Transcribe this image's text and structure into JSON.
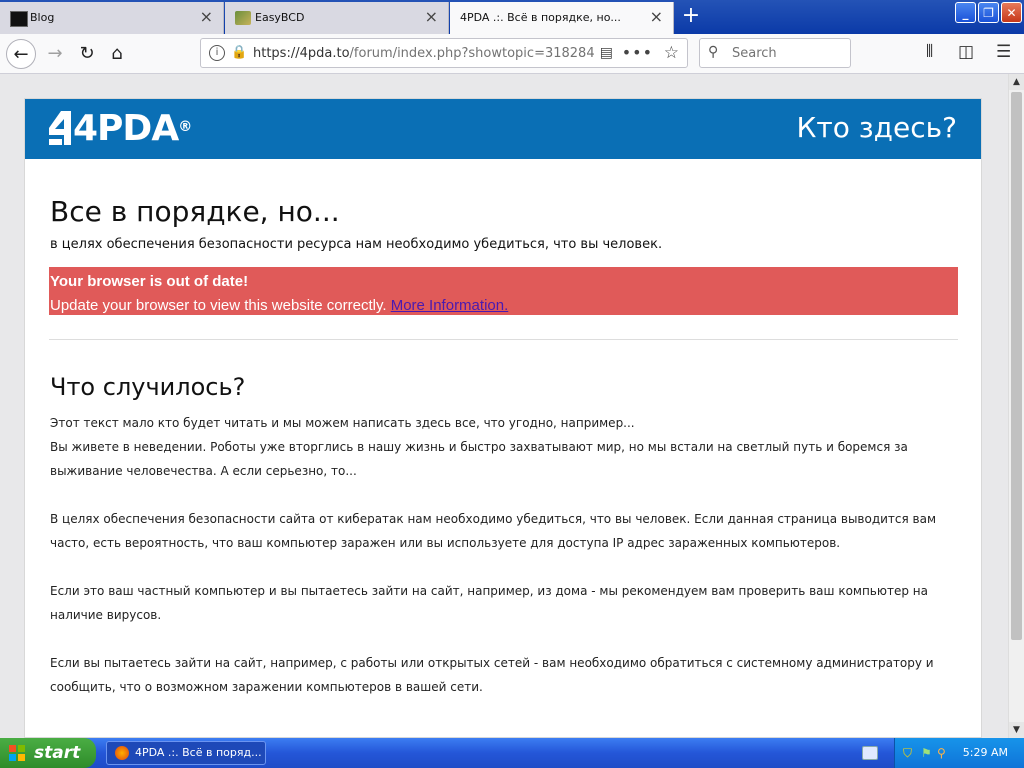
{
  "tabs": [
    {
      "label": "Blog",
      "close": "×"
    },
    {
      "label": "EasyBCD",
      "close": "×"
    },
    {
      "label": "4PDA .:. Всё в порядке, но...",
      "close": "×"
    }
  ],
  "new_tab": "+",
  "window_buttons": {
    "minimize": "_",
    "maximize": "❐",
    "close": "✕"
  },
  "nav": {
    "url_host": "https://4pda.to",
    "url_path": "/forum/index.php?showtopic=318284",
    "search_placeholder": "Search"
  },
  "site": {
    "logo_text": "4PDA",
    "logo_mark": "®",
    "header_title": "Кто здесь?",
    "heading": "Все в порядке, но...",
    "subheading": "в целях обеспечения безопасности ресурса нам необходимо убедиться, что вы человек.",
    "alert_title": "Your browser is out of date!",
    "alert_text": "Update your browser to view this website correctly.",
    "alert_link": "More Information.",
    "section_title": "Что случилось?",
    "para1_line1": "Этот текст мало кто будет читать и мы можем написать здесь все, что угодно, например...",
    "para1_line2": "Вы живете в неведении. Роботы уже вторглись в нашу жизнь и быстро захватывают мир, но мы встали на светлый путь и боремся за выживание человечества. А если серьезно, то...",
    "para2": "В целях обеспечения безопасности сайта от кибератак нам необходимо убедиться, что вы человек. Если данная страница выводится вам часто, есть вероятность, что ваш компьютер заражен или вы используете для доступа IP адрес зараженных компьютеров.",
    "para3": "Если это ваш частный компьютер и вы пытаетесь зайти на сайт, например, из дома - мы рекомендуем вам проверить ваш компьютер на наличие вирусов.",
    "para4": "Если вы пытаетесь зайти на сайт, например, с работы или открытых сетей - вам необходимо обратиться с системному администратору и сообщить, что о возможном заражении компьютеров в вашей сети."
  },
  "taskbar": {
    "start_label": "start",
    "task_label": "4PDA .:. Всё в поряд...",
    "clock": "5:29 AM"
  },
  "colors": {
    "header_blue": "#0a6fb5",
    "alert_red": "#e05a59",
    "link": "#4a1ab0"
  }
}
